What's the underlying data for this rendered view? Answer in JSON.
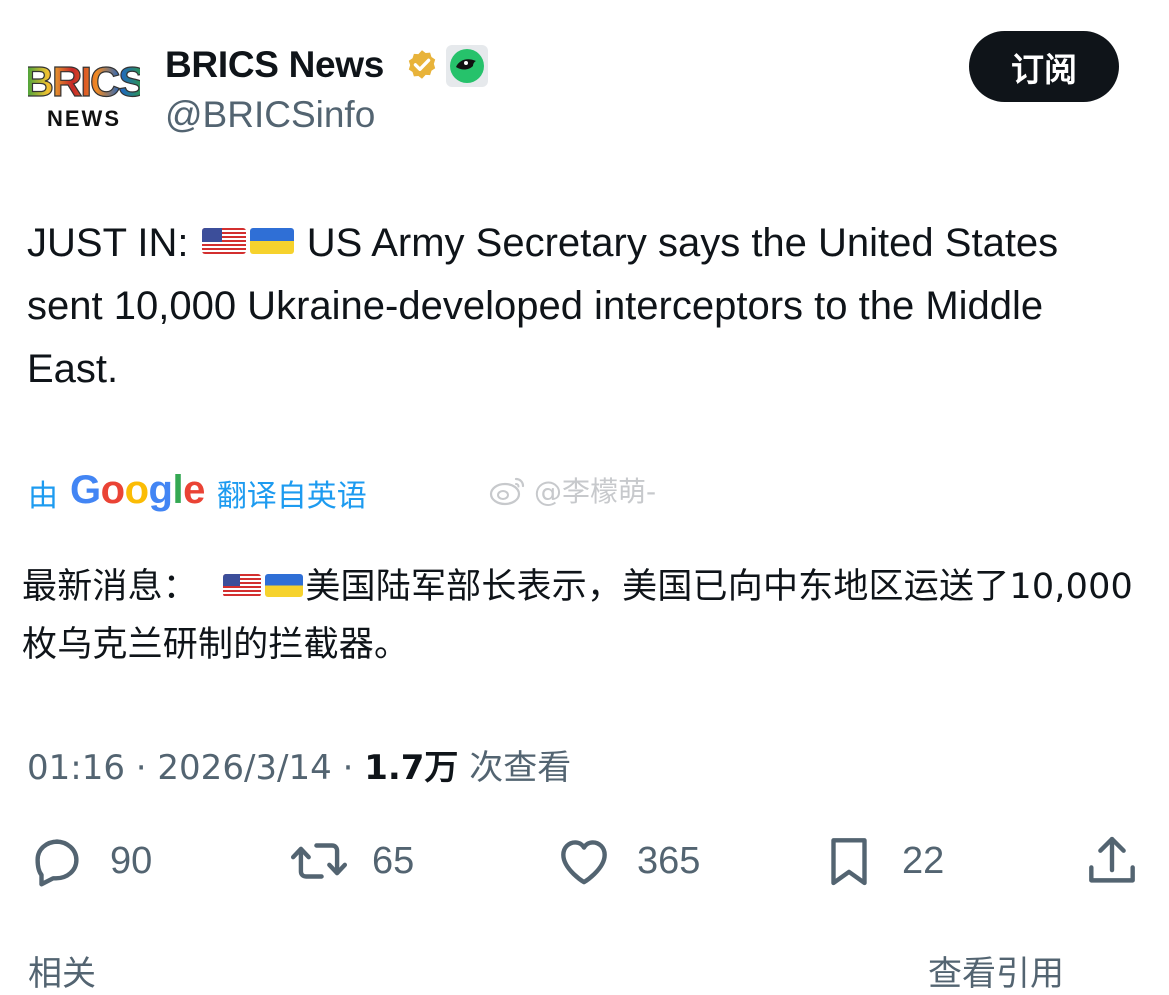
{
  "account": {
    "display_name": "BRICS News",
    "handle": "@BRICSinfo",
    "avatar_text_top": "BRICS",
    "avatar_text_bottom": "NEWS",
    "subscribe_label": "订阅"
  },
  "tweet": {
    "prefix": "JUST IN:",
    "text": "US Army Secretary says the United States sent 10,000 Ukraine-developed interceptors to the Middle East.",
    "flags": [
      "us-flag-icon",
      "ukraine-flag-icon"
    ]
  },
  "translation": {
    "by": "由",
    "google": "Google",
    "from": "翻译自英语",
    "prefix": "最新消息：",
    "text": "美国陆军部长表示，美国已向中东地区运送了10,000 枚乌克兰研制的拦截器。"
  },
  "watermark": "@李檬萌-",
  "meta": {
    "time": "01:16",
    "date": "2026/3/14",
    "views": "1.7万",
    "views_label": "次查看"
  },
  "actions": {
    "replies": "90",
    "reposts": "65",
    "likes": "365",
    "bookmarks": "22"
  },
  "bottom": {
    "left": "相关",
    "right": "查看引用"
  },
  "colors": {
    "text": "#0f1419",
    "secondary": "#536471",
    "link": "#1d9bf0",
    "button": "#0f1419",
    "verified": "#e8b33a"
  }
}
